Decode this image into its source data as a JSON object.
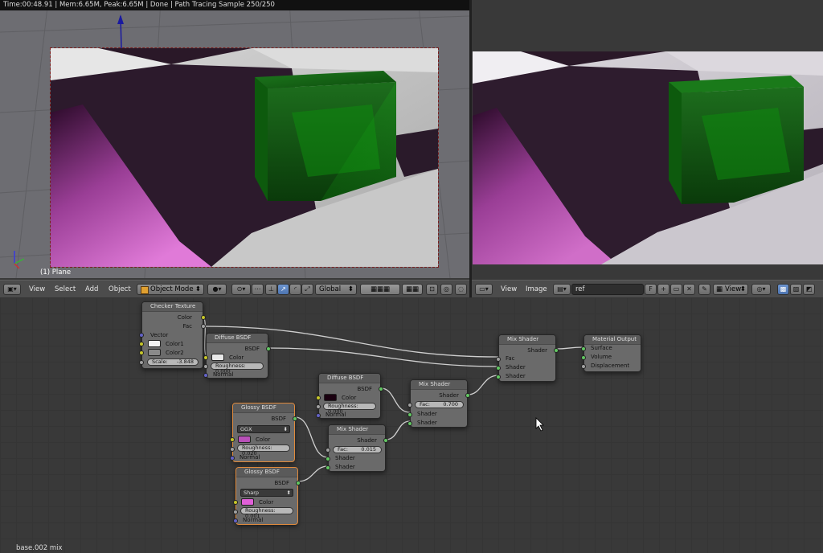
{
  "status": "Time:00:48.91 | Mem:6.65M, Peak:6.65M | Done | Path Tracing Sample 250/250",
  "viewport": {
    "object_label": "(1) Plane",
    "menus": [
      "View",
      "Select",
      "Add",
      "Object"
    ],
    "mode": "Object Mode",
    "orientation": "Global"
  },
  "image_editor": {
    "menus": [
      "View",
      "Image"
    ],
    "image_name": "ref",
    "fake_user": "F",
    "view_label": "View"
  },
  "node_editor_status": "base.002 mix",
  "nodes": {
    "checker": {
      "title": "Checker Texture",
      "out_color": "Color",
      "out_fac": "Fac",
      "in_vector": "Vector",
      "color1_label": "Color1",
      "color2_label": "Color2",
      "scale_label": "Scale:",
      "scale_value": "-3.848",
      "color1": "#f2f2f2",
      "color2": "#8a8a8a"
    },
    "diffuse1": {
      "title": "Diffuse BSDF",
      "out": "BSDF",
      "color_label": "Color",
      "roughness": "Roughness: 0.000",
      "normal": "Normal",
      "color": "#e8e8e8"
    },
    "diffuse2": {
      "title": "Diffuse BSDF",
      "out": "BSDF",
      "color_label": "Color",
      "roughness": "Roughness: 0.000",
      "normal": "Normal",
      "color": "#1a0010"
    },
    "glossy1": {
      "title": "Glossy BSDF",
      "out": "BSDF",
      "distribution": "GGX",
      "color_label": "Color",
      "roughness": "Roughness: 0.020",
      "normal": "Normal",
      "color": "#b850b8"
    },
    "glossy2": {
      "title": "Glossy BSDF",
      "out": "BSDF",
      "distribution": "Sharp",
      "color_label": "Color",
      "roughness": "Roughness: 0.001",
      "normal": "Normal",
      "color": "#e060d8"
    },
    "mix_small": {
      "title": "Mix Shader",
      "out": "Shader",
      "fac_label": "Fac:",
      "fac_value": "0.015",
      "in1": "Shader",
      "in2": "Shader"
    },
    "mix_mid": {
      "title": "Mix Shader",
      "out": "Shader",
      "fac_label": "Fac:",
      "fac_value": "0.700",
      "in1": "Shader",
      "in2": "Shader"
    },
    "mix_final": {
      "title": "Mix Shader",
      "out": "Shader",
      "fac_label": "Fac",
      "in1": "Shader",
      "in2": "Shader"
    },
    "output": {
      "title": "Material Output",
      "surface": "Surface",
      "volume": "Volume",
      "displacement": "Displacement"
    }
  },
  "icons": [
    "view3d-editor-icon",
    "object-mode-cube-icon",
    "viewport-shading-icon",
    "pivot-icon",
    "snap-icon",
    "manipulator-translate-icon",
    "manipulator-rotate-icon",
    "manipulator-scale-icon",
    "layers-icon",
    "lock-icon",
    "render-preview-icon",
    "image-editor-icon",
    "image-browse-icon",
    "new-image-icon",
    "open-image-icon",
    "close-icon",
    "pin-icon",
    "display-channels-icon",
    "sample-icon",
    "node-collapse-icon"
  ]
}
